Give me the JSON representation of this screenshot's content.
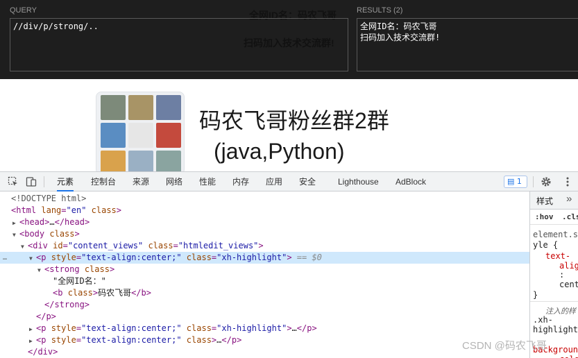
{
  "xpath_helper": {
    "query_label": "QUERY",
    "query_value": "//div/p/strong/..",
    "results_label": "RESULTS (2)",
    "results": [
      "全网ID名：码农飞哥",
      "扫码加入技术交流群!"
    ],
    "bg_text_1": "全网ID名：码农飞哥",
    "bg_text_2": "扫码加入技术交流群!"
  },
  "page": {
    "title_line1": "码农飞哥粉丝群2群",
    "title_line2": "(java,Python)"
  },
  "devtools": {
    "tabs": [
      "元素",
      "控制台",
      "来源",
      "网络",
      "性能",
      "内存",
      "应用",
      "安全",
      "Lighthouse",
      "AdBlock"
    ],
    "active_tab": "元素",
    "issues_count": "1",
    "dom": {
      "doctype": "<!DOCTYPE html>",
      "html_open_tag": "html",
      "html_attr1": "lang",
      "html_val1": "\"en\"",
      "html_attr2": "class",
      "head_tag": "head",
      "head_ellipsis": "…",
      "head_close": "</head>",
      "body_tag": "body",
      "body_attr": "class",
      "div_tag": "div",
      "div_attr1": "id",
      "div_val1": "\"content_views\"",
      "div_attr2": "class",
      "div_val2": "\"htmledit_views\"",
      "p_tag": "p",
      "p_attr1": "style",
      "p_val1": "\"text-align:center;\"",
      "p_attr2": "class",
      "p_val2": "\"xh-highlight\"",
      "p_eq": "== $0",
      "strong_tag": "strong",
      "strong_attr": "class",
      "text_node": "\"全网ID名：\"",
      "b_tag": "b",
      "b_attr": "class",
      "b_text": "码农飞哥",
      "b_close": "</b>",
      "strong_close": "</strong>",
      "p_close": "</p>",
      "p2_ellipsis": "…",
      "p2_close": "</p>",
      "p3_attr2": "class",
      "p3_ellipsis": "…",
      "p3_close": "</p>",
      "div_close": "</div>",
      "row_dots": "…"
    },
    "styles": {
      "tab_label": "样式",
      "more": "»",
      "hov": ":hov",
      "cls": ".cls",
      "selector_1": "element.s",
      "selector_1b": "yle {",
      "prop": "text-",
      "prop_b": "alig",
      "colon": ":",
      "value": "cent",
      "close_brace": "}",
      "injected": "注入的样",
      "selector_2": ".xh-",
      "selector_2b": "highlight",
      "prop_2": "backgroun",
      "prop_2b": "colo"
    }
  },
  "watermark": "CSDN @码农飞哥"
}
